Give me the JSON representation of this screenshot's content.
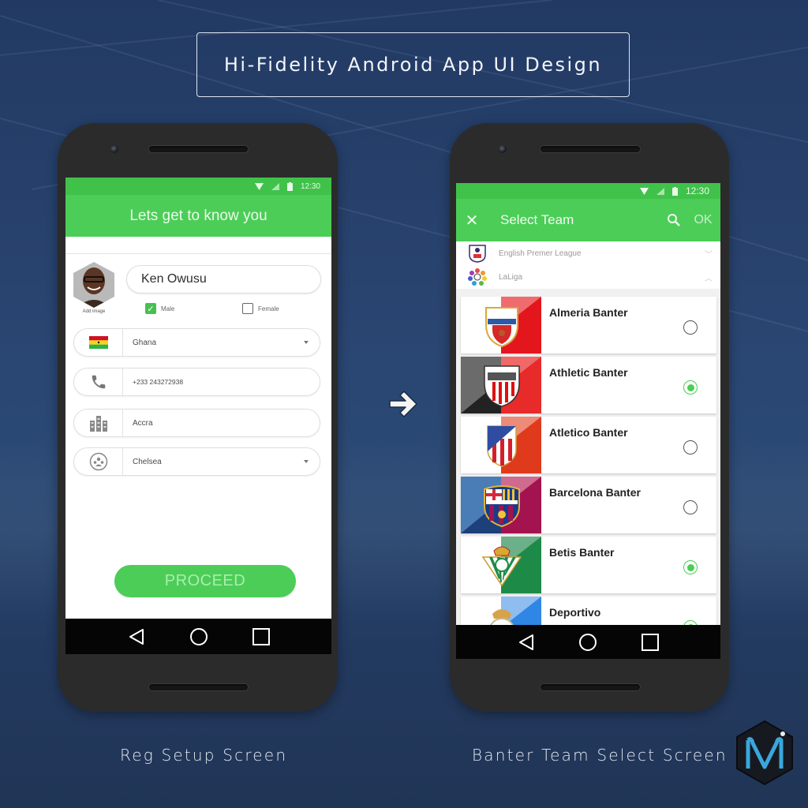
{
  "header": {
    "title": "Hi-Fidelity Android App UI Design"
  },
  "captions": {
    "left": "Reg Setup Screen",
    "right": "Banter Team Select Screen"
  },
  "colors": {
    "primary_green": "#4ccd57",
    "status_green": "#40c24a",
    "background_navy": "#243d66"
  },
  "reg_screen": {
    "status_time": "12:30",
    "title": "Lets get to know you",
    "add_image_label": "Add image",
    "name_value": "Ken Owusu",
    "gender": {
      "male_label": "Male",
      "female_label": "Female",
      "male_checked": true,
      "female_checked": false
    },
    "fields": [
      {
        "icon": "ghana-flag-icon",
        "value": "Ghana",
        "dropdown": true
      },
      {
        "icon": "phone-icon",
        "value": "+233 243272938",
        "dropdown": false
      },
      {
        "icon": "city-icon",
        "value": "Accra",
        "dropdown": false
      },
      {
        "icon": "team-icon",
        "value": "Chelsea",
        "dropdown": true
      }
    ],
    "proceed_label": "PROCEED"
  },
  "team_screen": {
    "status_time": "12:30",
    "title": "Select Team",
    "ok_label": "OK",
    "leagues": [
      {
        "name": "English Premer League",
        "expanded": false
      },
      {
        "name": "LaLiga",
        "expanded": true
      }
    ],
    "teams": [
      {
        "name": "Almeria Banter",
        "selected": false
      },
      {
        "name": "Athletic Banter",
        "selected": true
      },
      {
        "name": "Atletico Banter",
        "selected": false
      },
      {
        "name": "Barcelona Banter",
        "selected": false
      },
      {
        "name": "Betis Banter",
        "selected": true
      },
      {
        "name": "Deportivo",
        "selected": true
      }
    ]
  },
  "icons": {
    "arrow": "arrow-right-icon",
    "logo": "mi-logo-icon"
  }
}
